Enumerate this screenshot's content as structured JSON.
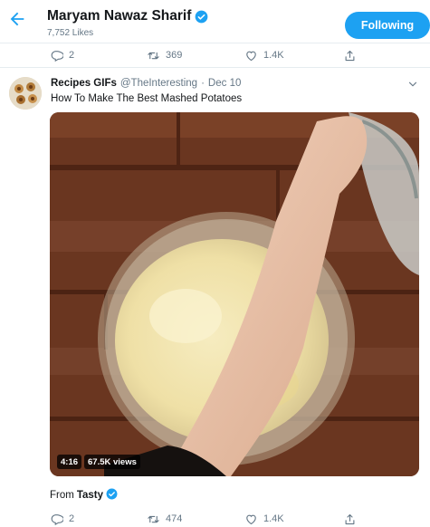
{
  "header": {
    "title": "Maryam Nawaz Sharif",
    "subtitle": "7,752 Likes",
    "follow_label": "Following",
    "accent": "#1da1f2"
  },
  "top_actions": {
    "replies": "2",
    "retweets": "369",
    "likes": "1.4K"
  },
  "tweet": {
    "name": "Recipes GIFs",
    "handle": "@TheInteresting",
    "separator": "·",
    "date": "Dec 10",
    "text": "How To Make The Best Mashed Potatoes",
    "video": {
      "duration": "4:16",
      "views": "67.5K views"
    },
    "from_prefix": "From",
    "from_source": "Tasty"
  },
  "bottom_actions": {
    "replies": "2",
    "retweets": "474",
    "likes": "1.4K"
  },
  "icons": [
    "back-arrow-icon",
    "verified-badge-icon",
    "reply-icon",
    "retweet-icon",
    "like-icon",
    "share-icon",
    "caret-down-icon"
  ]
}
